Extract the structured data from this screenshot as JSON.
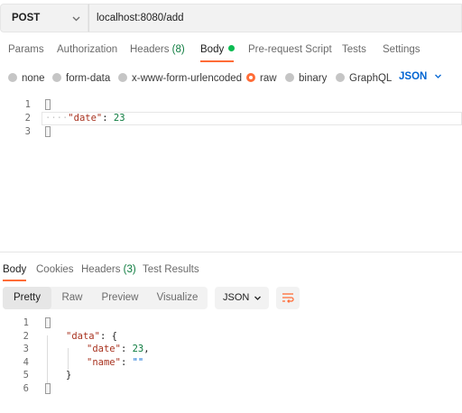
{
  "request": {
    "method": "POST",
    "url": "localhost:8080/add"
  },
  "request_tabs": [
    {
      "label": "Params"
    },
    {
      "label": "Authorization"
    },
    {
      "label": "Headers",
      "count": "(8)"
    },
    {
      "label": "Body"
    },
    {
      "label": "Pre-request Script"
    },
    {
      "label": "Tests"
    },
    {
      "label": "Settings"
    }
  ],
  "body_types": [
    {
      "label": "none"
    },
    {
      "label": "form-data"
    },
    {
      "label": "x-www-form-urlencoded"
    },
    {
      "label": "raw",
      "selected": true
    },
    {
      "label": "binary"
    },
    {
      "label": "GraphQL"
    }
  ],
  "body_format": "JSON",
  "editor": {
    "line_numbers": [
      "1",
      "2",
      "3"
    ],
    "key": "\"date\"",
    "colon": ": ",
    "value": "23"
  },
  "response_tabs": [
    {
      "label": "Body"
    },
    {
      "label": "Cookies"
    },
    {
      "label": "Headers",
      "count": "(3)"
    },
    {
      "label": "Test Results"
    }
  ],
  "response_views": [
    "Pretty",
    "Raw",
    "Preview",
    "Visualize"
  ],
  "response_format": "JSON",
  "response": {
    "line_numbers": [
      "1",
      "2",
      "3",
      "4",
      "5",
      "6"
    ],
    "data_key": "\"data\"",
    "colon_brace": ": {",
    "date_key": "\"date\"",
    "date_value": "23",
    "comma": ",",
    "name_key": "\"name\"",
    "name_value": "\"\"",
    "close_brace": "}"
  },
  "colors": {
    "accent": "#ff6c37",
    "active_dot": "#0cbb52",
    "json_link": "#0265d2",
    "key": "#a8321f",
    "number": "#0c7b3e",
    "string": "#0265d2"
  },
  "icons": {
    "method_dropdown": "chevron-down-icon",
    "format_dropdown": "chevron-down-icon",
    "wrap": "wrap-lines-icon"
  }
}
